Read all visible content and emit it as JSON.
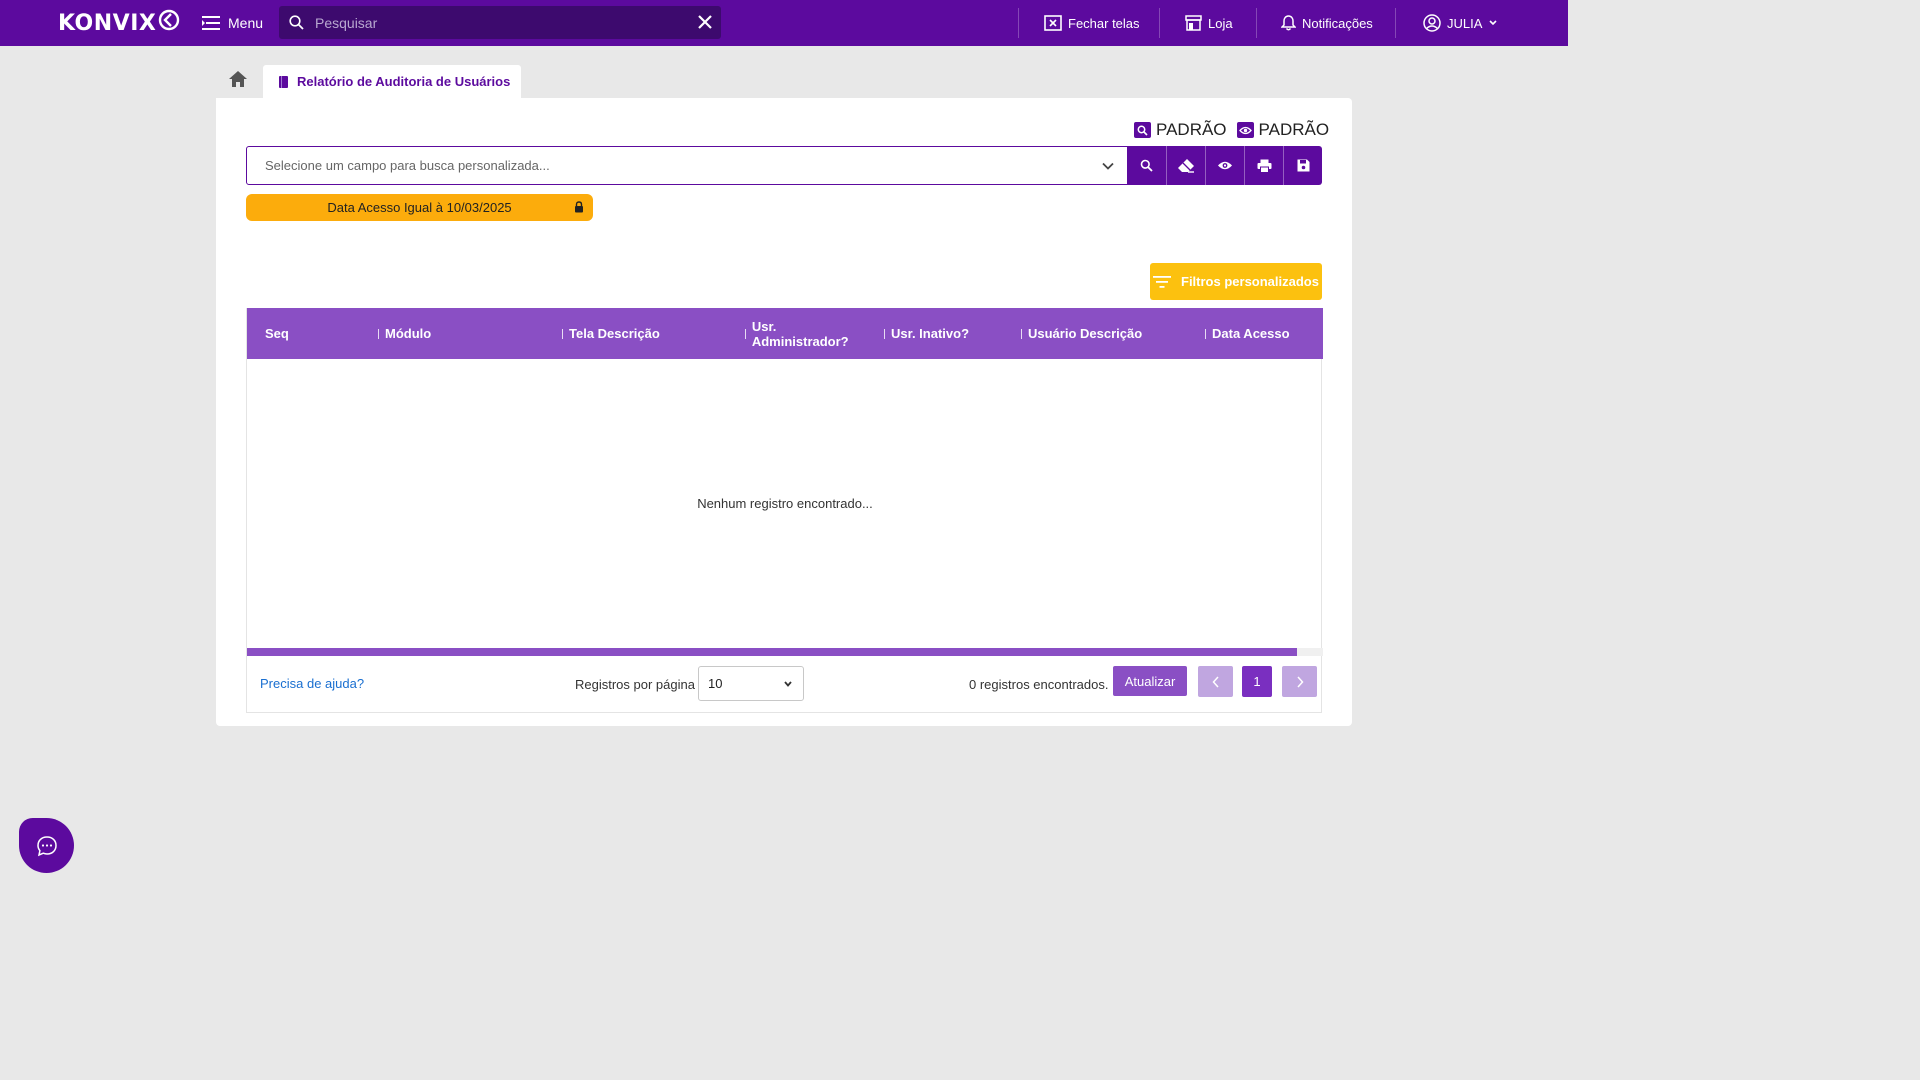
{
  "app": {
    "logo_text": "KONVIX",
    "menu_label": "Menu",
    "search_placeholder": "Pesquisar"
  },
  "topbar": {
    "close_screens_label": "Fechar telas",
    "store_label": "Loja",
    "notifications_label": "Notificações",
    "user_label": "JULIA"
  },
  "tabs": {
    "active_label": "Relatório de Auditoria de Usuários"
  },
  "toolbar": {
    "search_preset_label": "PADRÃO",
    "view_preset_label": "PADRÃO",
    "field_select_placeholder": "Selecione um campo para busca personalizada...",
    "actions": [
      "search-icon",
      "eraser-icon",
      "eye-icon",
      "print-icon",
      "save-icon"
    ]
  },
  "active_filter": {
    "label": "Data Acesso Igual à 10/03/2025"
  },
  "custom_filters_button": "Filtros personalizados",
  "table": {
    "columns": [
      "Seq",
      "Módulo",
      "Tela Descrição",
      "Usr. Administrador?",
      "Usr. Inativo?",
      "Usuário Descrição",
      "Data Acesso"
    ],
    "empty_message": "Nenhum registro encontrado...",
    "rows": []
  },
  "footer": {
    "help_link": "Precisa de ajuda?",
    "rows_per_page_label": "Registros por página",
    "rows_per_page_value": "10",
    "records_found": "0 registros encontrados.",
    "refresh_label": "Atualizar",
    "current_page": "1"
  },
  "colors": {
    "brand": "#5c0a9e",
    "header": "#8a4fc4",
    "filter_chip": "#fcac0c",
    "filters_button": "#fcc10f",
    "link": "#1a6fd0"
  }
}
